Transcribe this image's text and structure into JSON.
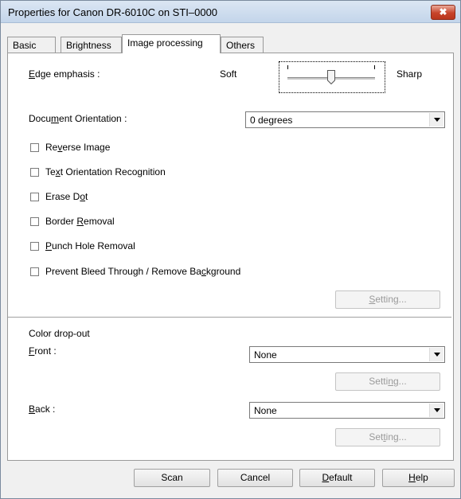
{
  "window": {
    "title": "Properties for Canon DR-6010C on STI–0000",
    "close_glyph": "✖"
  },
  "tabs": [
    {
      "label": "Basic",
      "active": false
    },
    {
      "label": "Brightness",
      "active": false
    },
    {
      "label": "Image processing",
      "active": true
    },
    {
      "label": "Others",
      "active": false
    }
  ],
  "edge": {
    "label_pre": "",
    "label_key": "E",
    "label_post": "dge emphasis :",
    "soft_label": "Soft",
    "sharp_label": "Sharp",
    "level_fraction": 0.5
  },
  "orientation": {
    "label_pre": "Docu",
    "label_key": "m",
    "label_post": "ent Orientation :",
    "value": "0 degrees"
  },
  "checkboxes": [
    {
      "pre": "Re",
      "key": "v",
      "post": "erse Image",
      "checked": false
    },
    {
      "pre": "Te",
      "key": "x",
      "post": "t Orientation Recognition",
      "checked": false
    },
    {
      "pre": "Erase D",
      "key": "o",
      "post": "t",
      "checked": false
    },
    {
      "pre": "Border ",
      "key": "R",
      "post": "emoval",
      "checked": false
    },
    {
      "pre": "",
      "key": "P",
      "post": "unch Hole Removal",
      "checked": false
    },
    {
      "pre": "Prevent Bleed Through / Remove Ba",
      "key": "c",
      "post": "kground",
      "checked": false
    }
  ],
  "setting_main": {
    "pre": "",
    "key": "S",
    "post": "etting..."
  },
  "dropout": {
    "heading": "Color drop-out",
    "front_key": "F",
    "front_post": "ront :",
    "front_value": "None",
    "front_setting": {
      "pre": "Setti",
      "key": "n",
      "post": "g..."
    },
    "back_key": "B",
    "back_post": "ack :",
    "back_value": "None",
    "back_setting": {
      "pre": "Set",
      "key": "t",
      "post": "ing..."
    }
  },
  "buttons": {
    "scan": "Scan",
    "cancel": "Cancel",
    "default_key": "D",
    "default_post": "efault",
    "help_key": "H",
    "help_post": "elp"
  }
}
